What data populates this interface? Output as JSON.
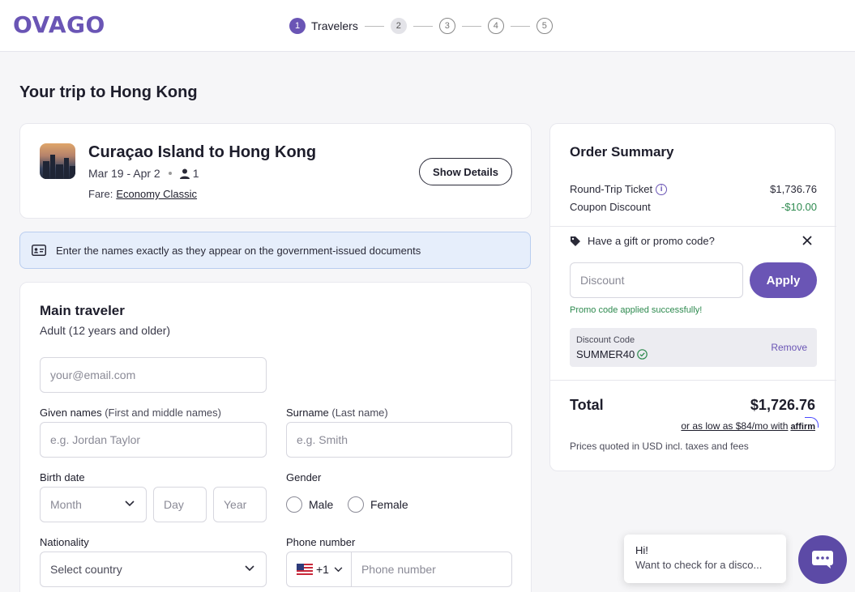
{
  "header": {
    "logo": "OVAGO",
    "steps": [
      {
        "num": "1",
        "label": "Travelers"
      },
      {
        "num": "2"
      },
      {
        "num": "3"
      },
      {
        "num": "4"
      },
      {
        "num": "5"
      }
    ]
  },
  "page_title": "Your trip to Hong Kong",
  "trip": {
    "route": "Curaçao Island to Hong Kong",
    "dates": "Mar 19 - Apr 2",
    "passengers": "1",
    "fare_label": "Fare:",
    "fare_value": "Economy Classic",
    "details_button": "Show Details"
  },
  "notice": "Enter the names exactly as they appear on the government-issued documents",
  "traveler_form": {
    "title": "Main traveler",
    "subtitle": "Adult (12 years and older)",
    "email_placeholder": "your@email.com",
    "given_label": "Given names",
    "given_hint": "(First and middle names)",
    "given_placeholder": "e.g. Jordan Taylor",
    "surname_label": "Surname",
    "surname_hint": "(Last name)",
    "surname_placeholder": "e.g. Smith",
    "birth_label": "Birth date",
    "month_placeholder": "Month",
    "day_placeholder": "Day",
    "year_placeholder": "Year",
    "gender_label": "Gender",
    "gender_options": [
      "Male",
      "Female"
    ],
    "nationality_label": "Nationality",
    "nationality_placeholder": "Select country",
    "phone_label": "Phone number",
    "phone_code": "+1",
    "phone_placeholder": "Phone number"
  },
  "summary": {
    "title": "Order Summary",
    "ticket_label": "Round-Trip Ticket",
    "ticket_value": "$1,736.76",
    "coupon_label": "Coupon Discount",
    "coupon_value": "-$10.00",
    "promo_question": "Have a gift or promo code?",
    "discount_placeholder": "Discount",
    "apply_button": "Apply",
    "promo_success": "Promo code applied successfully!",
    "code_label": "Discount Code",
    "code_value": "SUMMER40",
    "remove_label": "Remove",
    "total_label": "Total",
    "total_value": "$1,726.76",
    "affirm_text": "or as low as $84/mo with",
    "affirm_brand": "affirm",
    "prices_note": "Prices quoted in USD incl. taxes and fees"
  },
  "chat": {
    "greeting": "Hi!",
    "message": "Want to check for a disco..."
  },
  "colors": {
    "brand": "#6a55b5",
    "success": "#2e8a4f",
    "notice_bg": "#e6eefb"
  }
}
